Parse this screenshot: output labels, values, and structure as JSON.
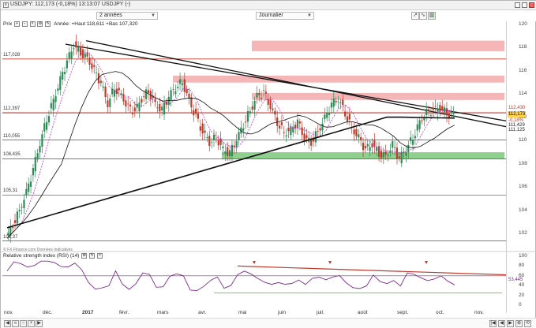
{
  "window": {
    "title": "USDJPY: 112,173 (-0,18%) 13:13:07 USDJPY (-)"
  },
  "toolbar": {
    "period": "2 années",
    "interval": "Journalier"
  },
  "header": {
    "price_label": "Prix",
    "info": "Année: +Haut 118,611 +Bas 107,320"
  },
  "credit": "© FX Finance.com Données Indicatives",
  "price_axis": {
    "ticks": [
      "120",
      "118",
      "116",
      "114",
      "112",
      "110",
      "108",
      "106",
      "104",
      "102"
    ],
    "left_levels": [
      "117,028",
      "112,397",
      "110,055",
      "108,435",
      "105,31",
      "101,37"
    ]
  },
  "price_tags": [
    {
      "text": "112,430",
      "color": "#c0392b"
    },
    {
      "text": "112,173",
      "color": "#000",
      "bg": "#ffd24d"
    },
    {
      "text": "-0,18%",
      "color": "#c0392b"
    },
    {
      "text": "111,429",
      "color": "#222"
    },
    {
      "text": "111,125",
      "color": "#222"
    }
  ],
  "rsi": {
    "header": "Relative strength index (RSI) (14)",
    "ticks": [
      "100",
      "80",
      "60",
      "40",
      "20",
      "0"
    ],
    "value": "53,445"
  },
  "x_axis": [
    "nov.",
    "déc.",
    "2017",
    "févr.",
    "mars",
    "avr.",
    "mai",
    "juin",
    "juil.",
    "août",
    "sept.",
    "oct.",
    "nov."
  ],
  "colors": {
    "bull": "#2e8b57",
    "bear": "#c0392b",
    "resistance_zone": "#f4b6b6",
    "support_zone": "#8fd08f",
    "rsi": "#7b2d8e",
    "ma200": "#111111"
  },
  "chart_data": {
    "type": "candlestick",
    "symbol": "USDJPY",
    "ylim": [
      101,
      120
    ],
    "x_labels": [
      "nov.",
      "déc.",
      "2017",
      "févr.",
      "mars",
      "avr.",
      "mai",
      "juin",
      "juil.",
      "août",
      "sept.",
      "oct.",
      "nov."
    ],
    "close_path": [
      101.6,
      102.8,
      104.0,
      105.5,
      107.5,
      109.8,
      111.9,
      113.5,
      115.2,
      116.8,
      118.2,
      117.6,
      117.1,
      116.0,
      114.9,
      113.2,
      114.6,
      113.9,
      112.8,
      112.5,
      113.6,
      114.3,
      113.1,
      112.6,
      113.8,
      114.6,
      115.1,
      113.4,
      112.0,
      110.7,
      109.9,
      110.3,
      109.2,
      108.9,
      110.1,
      111.4,
      112.6,
      113.8,
      114.1,
      112.9,
      111.6,
      110.7,
      110.9,
      111.6,
      110.2,
      109.9,
      110.8,
      111.9,
      113.1,
      113.6,
      112.4,
      111.1,
      110.2,
      109.2,
      109.7,
      108.9,
      108.7,
      109.6,
      108.4,
      109.3,
      110.3,
      111.6,
      112.4,
      112.6,
      112.8,
      112.4,
      112.2
    ]
  }
}
